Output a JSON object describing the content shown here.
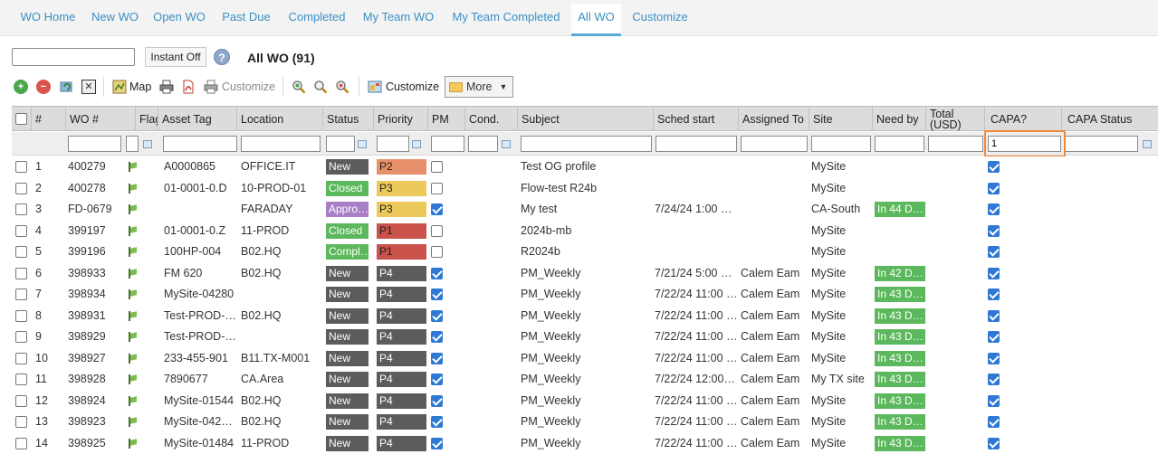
{
  "tabs": [
    {
      "label": "WO Home",
      "active": false
    },
    {
      "label": "New WO",
      "active": false
    },
    {
      "label": "Open WO",
      "active": false
    },
    {
      "label": "Past Due",
      "active": false
    },
    {
      "label": "Completed",
      "active": false
    },
    {
      "label": "My Team WO",
      "active": false
    },
    {
      "label": "My Team Completed",
      "active": false
    },
    {
      "label": "All WO",
      "active": true
    },
    {
      "label": "Customize",
      "active": false
    }
  ],
  "search": {
    "value": "",
    "instant_label": "Instant Off",
    "help": "?"
  },
  "view_title": "All WO (91)",
  "toolbar": {
    "map_label": "Map",
    "customize_report_label": "Customize",
    "customize_label": "Customize",
    "more_label": "More"
  },
  "columns": [
    "#",
    "WO #",
    "Flag",
    "Asset Tag",
    "Location",
    "Status",
    "Priority",
    "PM",
    "Cond.",
    "Subject",
    "Sched start",
    "Assigned To",
    "Site",
    "Need by",
    "Total (USD)",
    "CAPA?",
    "CAPA Status"
  ],
  "filters": {
    "capa": "1"
  },
  "colors": {
    "New": "#5c5c5c",
    "Closed": "#5cb85c",
    "Approved": "#a87fc7",
    "Completed": "#5cb85c",
    "P1": "#c9524b",
    "P2": "#e8906a",
    "P3": "#ecc95a",
    "P4": "#5c5c5c",
    "needby": "#5cb85c",
    "accent": "#3a8fc4"
  },
  "rows": [
    {
      "n": "1",
      "wo": "400279",
      "asset": "A0000865",
      "location": "OFFICE.IT",
      "status": "New",
      "priority": "P2",
      "pm": false,
      "subject": "Test OG profile",
      "sched": "",
      "assigned": "",
      "site": "MySite",
      "needby": "",
      "capa": true
    },
    {
      "n": "2",
      "wo": "400278",
      "asset": "01-0001-0.D",
      "location": "10-PROD-01",
      "status": "Closed",
      "priority": "P3",
      "pm": false,
      "subject": "Flow-test R24b",
      "sched": "",
      "assigned": "",
      "site": "MySite",
      "needby": "",
      "capa": true
    },
    {
      "n": "3",
      "wo": "FD-0679",
      "asset": "",
      "location": "FARADAY",
      "status": "Appro…",
      "statusKey": "Approved",
      "priority": "P3",
      "pm": true,
      "subject": "My test",
      "sched": "7/24/24 1:00 …",
      "assigned": "",
      "site": "CA-South",
      "needby": "In 44 D…",
      "capa": true
    },
    {
      "n": "4",
      "wo": "399197",
      "asset": "01-0001-0.Z",
      "location": "11-PROD",
      "status": "Closed",
      "priority": "P1",
      "pm": false,
      "subject": "2024b-mb",
      "sched": "",
      "assigned": "",
      "site": "MySite",
      "needby": "",
      "capa": true
    },
    {
      "n": "5",
      "wo": "399196",
      "asset": "100HP-004",
      "location": "B02.HQ",
      "status": "Compl…",
      "statusKey": "Completed",
      "priority": "P1",
      "pm": false,
      "subject": "R2024b",
      "sched": "",
      "assigned": "",
      "site": "MySite",
      "needby": "",
      "capa": true
    },
    {
      "n": "6",
      "wo": "398933",
      "asset": "FM 620",
      "location": "B02.HQ",
      "status": "New",
      "priority": "P4",
      "pm": true,
      "subject": "PM_Weekly",
      "sched": "7/21/24 5:00 …",
      "assigned": "Calem Eam",
      "site": "MySite",
      "needby": "In 42 D…",
      "capa": true
    },
    {
      "n": "7",
      "wo": "398934",
      "asset": "MySite-04280",
      "location": "",
      "status": "New",
      "priority": "P4",
      "pm": true,
      "subject": "PM_Weekly",
      "sched": "7/22/24 11:00 …",
      "assigned": "Calem Eam",
      "site": "MySite",
      "needby": "In 43 D…",
      "capa": true
    },
    {
      "n": "8",
      "wo": "398931",
      "asset": "Test-PROD-0…",
      "location": "B02.HQ",
      "status": "New",
      "priority": "P4",
      "pm": true,
      "subject": "PM_Weekly",
      "sched": "7/22/24 11:00 …",
      "assigned": "Calem Eam",
      "site": "MySite",
      "needby": "In 43 D…",
      "capa": true
    },
    {
      "n": "9",
      "wo": "398929",
      "asset": "Test-PROD-0…",
      "location": "",
      "status": "New",
      "priority": "P4",
      "pm": true,
      "subject": "PM_Weekly",
      "sched": "7/22/24 11:00 …",
      "assigned": "Calem Eam",
      "site": "MySite",
      "needby": "In 43 D…",
      "capa": true
    },
    {
      "n": "10",
      "wo": "398927",
      "asset": "233-455-901",
      "location": "B11.TX-M001",
      "status": "New",
      "priority": "P4",
      "pm": true,
      "subject": "PM_Weekly",
      "sched": "7/22/24 11:00 …",
      "assigned": "Calem Eam",
      "site": "MySite",
      "needby": "In 43 D…",
      "capa": true
    },
    {
      "n": "11",
      "wo": "398928",
      "asset": "7890677",
      "location": "CA.Area",
      "status": "New",
      "priority": "P4",
      "pm": true,
      "subject": "PM_Weekly",
      "sched": "7/22/24 12:00 …",
      "assigned": "Calem Eam",
      "site": "My TX site",
      "needby": "In 43 D…",
      "capa": true
    },
    {
      "n": "12",
      "wo": "398924",
      "asset": "MySite-01544",
      "location": "B02.HQ",
      "status": "New",
      "priority": "P4",
      "pm": true,
      "subject": "PM_Weekly",
      "sched": "7/22/24 11:00 …",
      "assigned": "Calem Eam",
      "site": "MySite",
      "needby": "In 43 D…",
      "capa": true
    },
    {
      "n": "13",
      "wo": "398923",
      "asset": "MySite-0427…",
      "location": "B02.HQ",
      "status": "New",
      "priority": "P4",
      "pm": true,
      "subject": "PM_Weekly",
      "sched": "7/22/24 11:00 …",
      "assigned": "Calem Eam",
      "site": "MySite",
      "needby": "In 43 D…",
      "capa": true
    },
    {
      "n": "14",
      "wo": "398925",
      "asset": "MySite-01484",
      "location": "11-PROD",
      "status": "New",
      "priority": "P4",
      "pm": true,
      "subject": "PM_Weekly",
      "sched": "7/22/24 11:00 …",
      "assigned": "Calem Eam",
      "site": "MySite",
      "needby": "In 43 D…",
      "capa": true
    }
  ]
}
